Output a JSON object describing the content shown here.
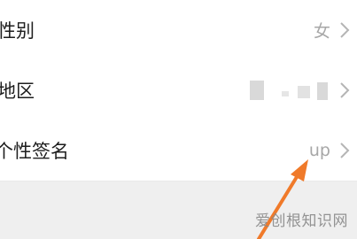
{
  "rows": [
    {
      "label": "性别",
      "value": "女"
    },
    {
      "label": "地区",
      "value": ""
    },
    {
      "label": "个性签名",
      "value": "up"
    }
  ],
  "watermark": "爱创根知识网",
  "colors": {
    "arrow": "#f07a2a",
    "background": "#ffffff",
    "divider": "#e9e9e9",
    "footer": "#efefef"
  }
}
